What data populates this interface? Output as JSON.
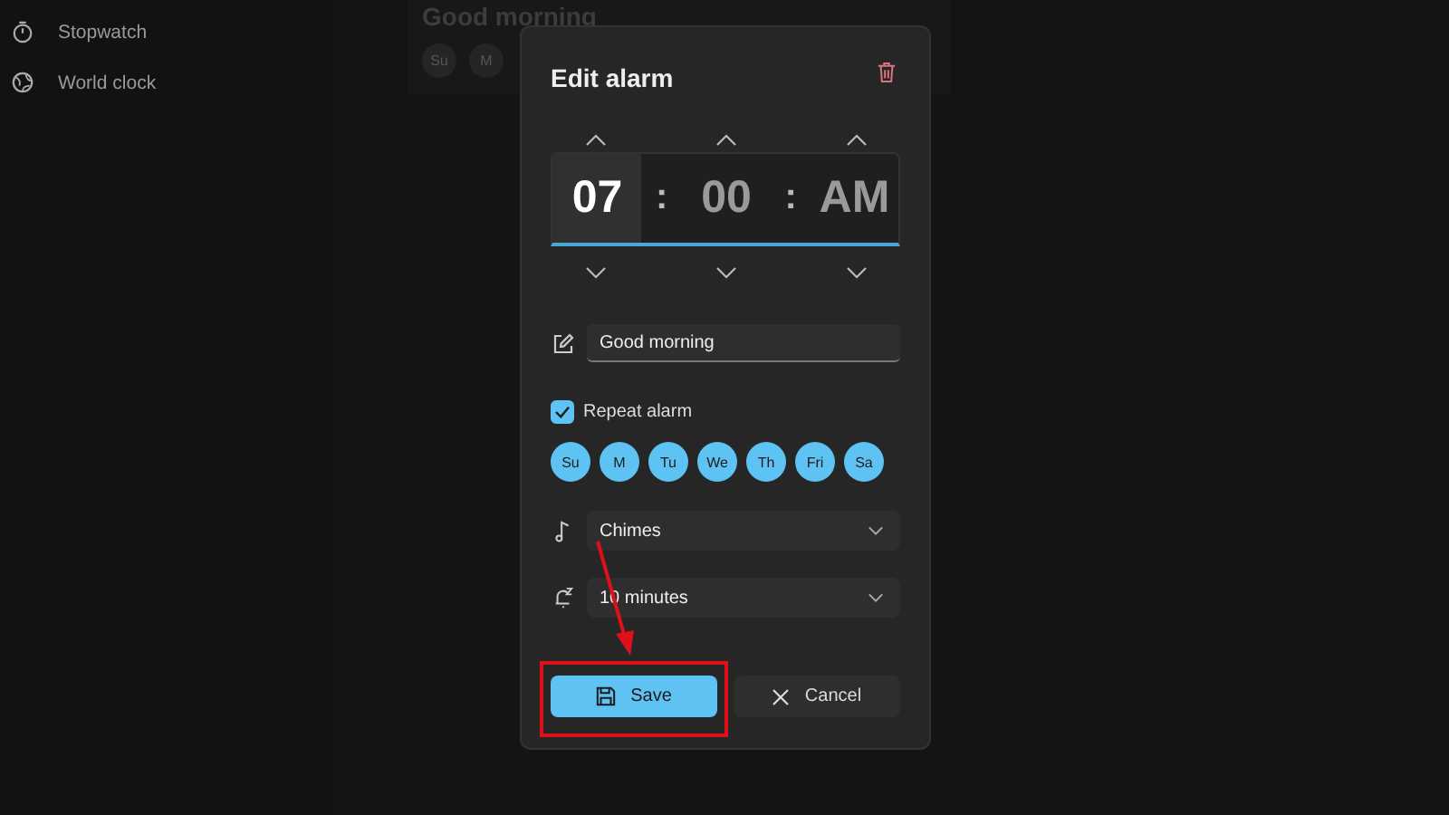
{
  "sidebar": {
    "items": [
      {
        "label": "Stopwatch",
        "kind": "stopwatch"
      },
      {
        "label": "World clock",
        "kind": "globe"
      }
    ]
  },
  "background_alarm": {
    "title": "Good morning",
    "days": [
      "Su",
      "M"
    ]
  },
  "dialog": {
    "title": "Edit alarm",
    "time": {
      "segments": [
        {
          "value": "07",
          "selected": true
        },
        {
          "value": "00",
          "selected": false
        },
        {
          "value": "AM",
          "selected": false
        }
      ],
      "separators": [
        ":",
        ":"
      ]
    },
    "name_field": {
      "value": "Good morning"
    },
    "repeat": {
      "label": "Repeat alarm",
      "checked": true
    },
    "days": [
      {
        "label": "Su",
        "selected": true
      },
      {
        "label": "M",
        "selected": true
      },
      {
        "label": "Tu",
        "selected": true
      },
      {
        "label": "We",
        "selected": true
      },
      {
        "label": "Th",
        "selected": true
      },
      {
        "label": "Fri",
        "selected": true
      },
      {
        "label": "Sa",
        "selected": true
      }
    ],
    "sound": {
      "value": "Chimes"
    },
    "snooze": {
      "value": "10 minutes"
    },
    "buttons": [
      {
        "label": "Save",
        "kind": "primary",
        "highlighted": true
      },
      {
        "label": "Cancel",
        "kind": "secondary",
        "highlighted": false
      }
    ]
  }
}
